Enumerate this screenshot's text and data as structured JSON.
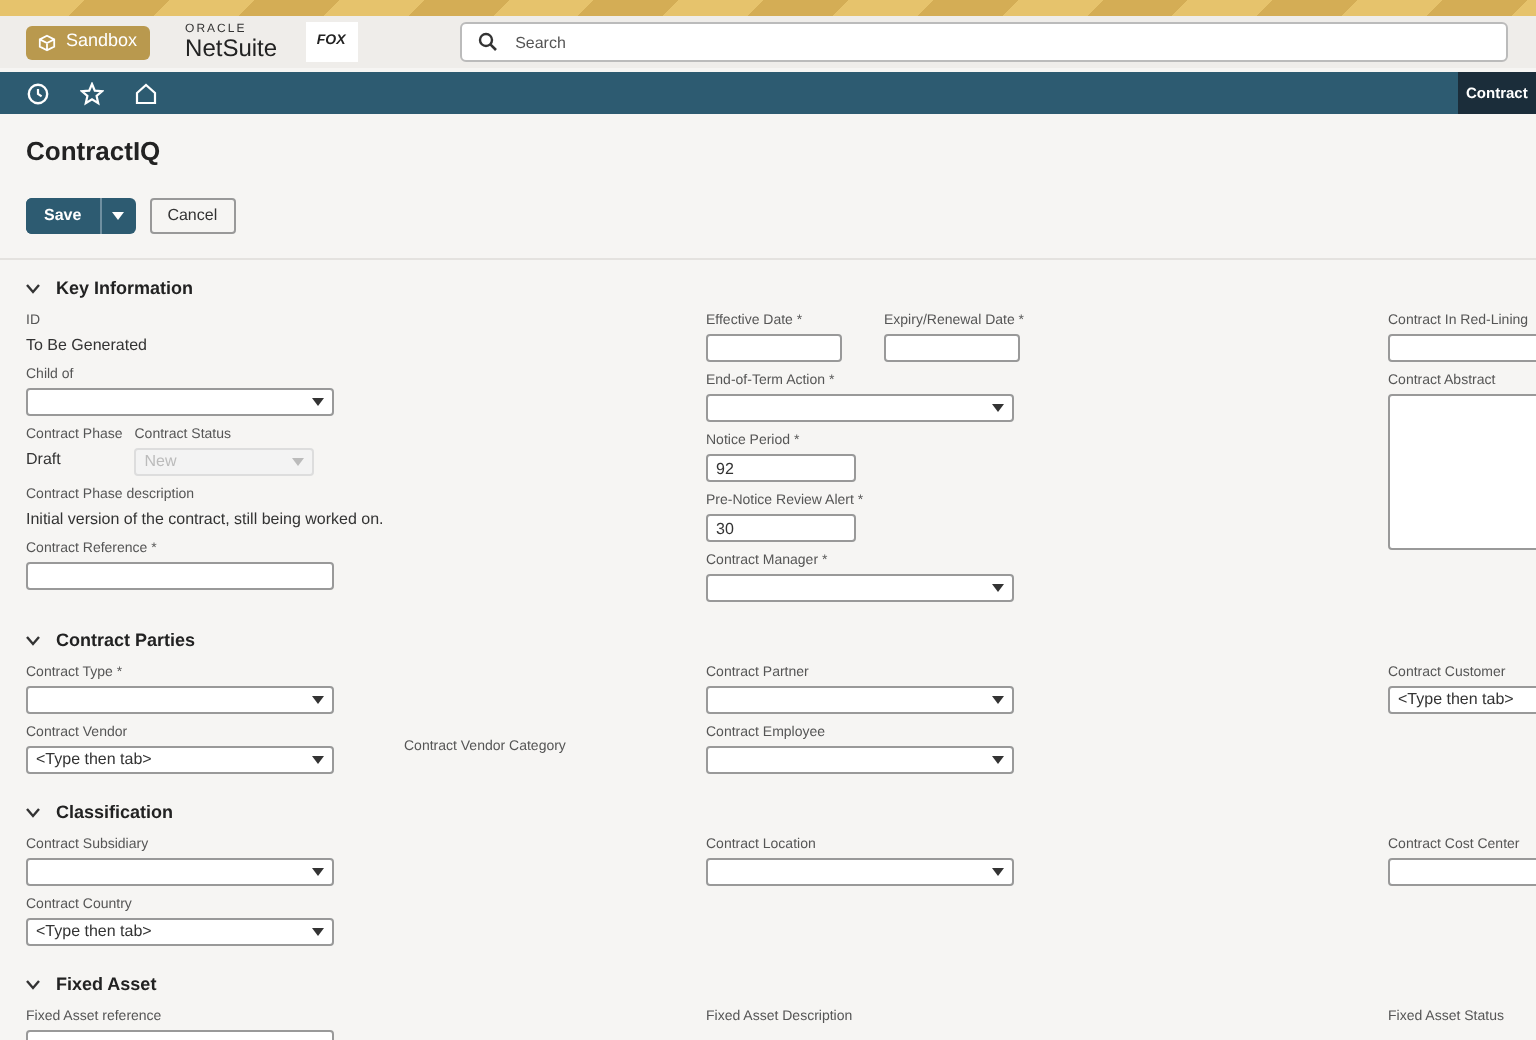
{
  "header": {
    "environment_badge": "Sandbox",
    "logo": {
      "small": "ORACLE",
      "large": "NetSuite"
    },
    "company_logo": "FOX",
    "search": {
      "placeholder": "Search"
    }
  },
  "nav_bar": {
    "current_tab": "Contract"
  },
  "page": {
    "title": "ContractIQ",
    "buttons": [
      {
        "label": "Save",
        "kind": "primary"
      },
      {
        "label": "Cancel",
        "kind": "secondary"
      }
    ]
  },
  "sections": [
    {
      "title": "Key Information",
      "expanded": true,
      "columns": [
        [
          {
            "kind": "static",
            "label": "ID",
            "value": "To Be Generated"
          },
          {
            "kind": "select",
            "label": "Child of",
            "disabled": false
          },
          {
            "kind": "pair",
            "items": [
              {
                "kind": "static",
                "label": "Contract Phase",
                "value": "Draft"
              },
              {
                "kind": "select",
                "label": "Contract Status",
                "value": "New",
                "disabled": true
              }
            ]
          },
          {
            "kind": "static",
            "label": "Contract Phase description",
            "value": "Initial version of the contract, still being worked on."
          },
          {
            "kind": "text",
            "label": "Contract Reference *"
          }
        ],
        [
          {
            "kind": "pair",
            "items": [
              {
                "kind": "text",
                "label": "Effective Date *"
              },
              {
                "kind": "text",
                "label": "Expiry/Renewal Date *"
              }
            ]
          },
          {
            "kind": "select",
            "label": "End-of-Term Action *",
            "disabled": false
          },
          {
            "kind": "text",
            "label": "Notice Period *",
            "value": "92"
          },
          {
            "kind": "text",
            "label": "Pre-Notice Review Alert *",
            "value": "30"
          },
          {
            "kind": "select",
            "label": "Contract Manager *",
            "disabled": false
          }
        ],
        [
          {
            "kind": "text",
            "label": "Contract In Red-Lining"
          },
          {
            "kind": "textarea",
            "label": "Contract Abstract"
          }
        ]
      ]
    },
    {
      "title": "Contract Parties",
      "expanded": true,
      "columns": [
        [
          {
            "kind": "select",
            "label": "Contract Type *",
            "disabled": false
          },
          {
            "kind": "pair",
            "items": [
              {
                "kind": "select",
                "label": "Contract Vendor",
                "placeholder": "<Type then tab>",
                "disabled": false
              },
              {
                "kind": "caption",
                "label": "Contract Vendor Category"
              }
            ]
          }
        ],
        [
          {
            "kind": "select",
            "label": "Contract Partner",
            "disabled": false
          },
          {
            "kind": "select",
            "label": "Contract Employee",
            "disabled": false
          }
        ],
        [
          {
            "kind": "select",
            "label": "Contract Customer",
            "placeholder": "<Type then tab>",
            "disabled": false
          }
        ]
      ]
    },
    {
      "title": "Classification",
      "expanded": true,
      "columns": [
        [
          {
            "kind": "select",
            "label": "Contract Subsidiary",
            "disabled": false
          },
          {
            "kind": "select",
            "label": "Contract Country",
            "placeholder": "<Type then tab>",
            "disabled": false
          }
        ],
        [
          {
            "kind": "select",
            "label": "Contract Location",
            "disabled": false
          }
        ],
        [
          {
            "kind": "select",
            "label": "Contract Cost Center",
            "disabled": false
          }
        ]
      ]
    },
    {
      "title": "Fixed Asset",
      "expanded": true,
      "columns": [
        [
          {
            "kind": "select",
            "label": "Fixed Asset reference",
            "disabled": false
          }
        ],
        [
          {
            "kind": "caption",
            "label": "Fixed Asset Description"
          }
        ],
        [
          {
            "kind": "caption",
            "label": "Fixed Asset Status"
          }
        ]
      ]
    }
  ]
}
